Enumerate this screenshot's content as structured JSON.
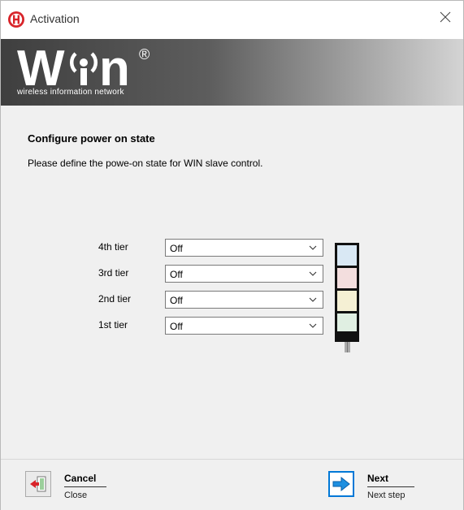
{
  "window": {
    "title": "Activation",
    "close_glyph": "×"
  },
  "banner": {
    "logo_text": "W",
    "logo_end": "n",
    "registered": "®",
    "tagline": "wireless information network"
  },
  "page": {
    "heading": "Configure power on state",
    "description": "Please define the powe-on state for WIN slave control."
  },
  "tiers": [
    {
      "label": "4th tier",
      "value": "Off",
      "color": "#d9e8f4"
    },
    {
      "label": "3rd tier",
      "value": "Off",
      "color": "#f3dede"
    },
    {
      "label": "2nd tier",
      "value": "Off",
      "color": "#f5f0d4"
    },
    {
      "label": "1st tier",
      "value": "Off",
      "color": "#e0efe2"
    }
  ],
  "footer": {
    "cancel": {
      "label": "Cancel",
      "sub": "Close"
    },
    "next": {
      "label": "Next",
      "sub": "Next step"
    }
  },
  "colors": {
    "accent": "#0078d7",
    "app_icon": "#d8242a",
    "banner_dark": "#3f3f3f"
  }
}
